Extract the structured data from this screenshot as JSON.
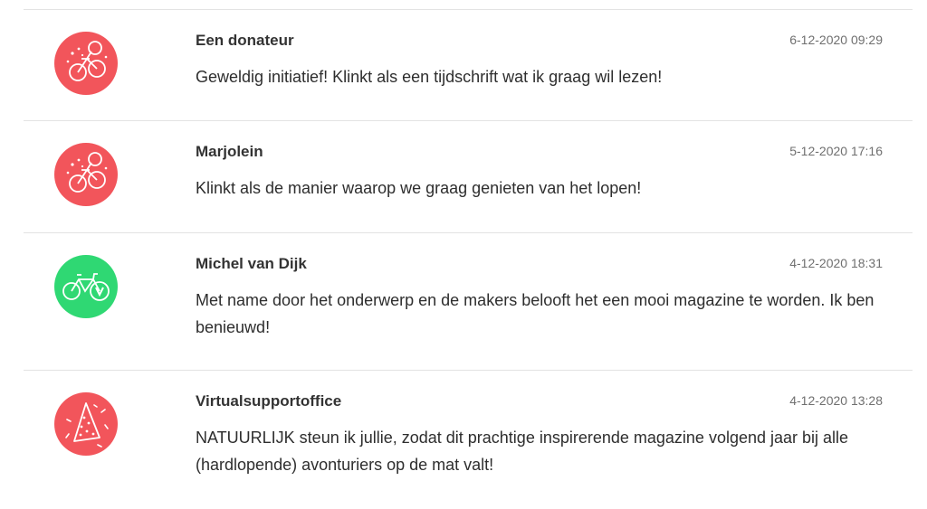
{
  "comments": [
    {
      "author": "Een donateur",
      "date": "6-12-2020 09:29",
      "text": "Geweldig initiatief! Klinkt als een tijdschrift wat ik graag wil lezen!",
      "avatar_icon": "bicycle-sparkle-icon",
      "avatar_color": "#f2555b"
    },
    {
      "author": "Marjolein",
      "date": "5-12-2020 17:16",
      "text": "Klinkt als de manier waarop we graag genieten van het lopen!",
      "avatar_icon": "bicycle-sparkle-icon",
      "avatar_color": "#f2555b"
    },
    {
      "author": "Michel van Dijk",
      "date": "4-12-2020 18:31",
      "text": "Met name door het onderwerp en de makers belooft het een mooi magazine te worden. Ik ben benieuwd!",
      "avatar_icon": "bike-v-icon",
      "avatar_color": "#2fd873"
    },
    {
      "author": "Virtualsupportoffice",
      "date": "4-12-2020 13:28",
      "text": "NATUURLIJK steun ik jullie, zodat dit prachtige inspirerende magazine volgend jaar bij alle (hardlopende) avonturiers op de mat valt!",
      "avatar_icon": "party-hat-icon",
      "avatar_color": "#f2555b"
    }
  ]
}
